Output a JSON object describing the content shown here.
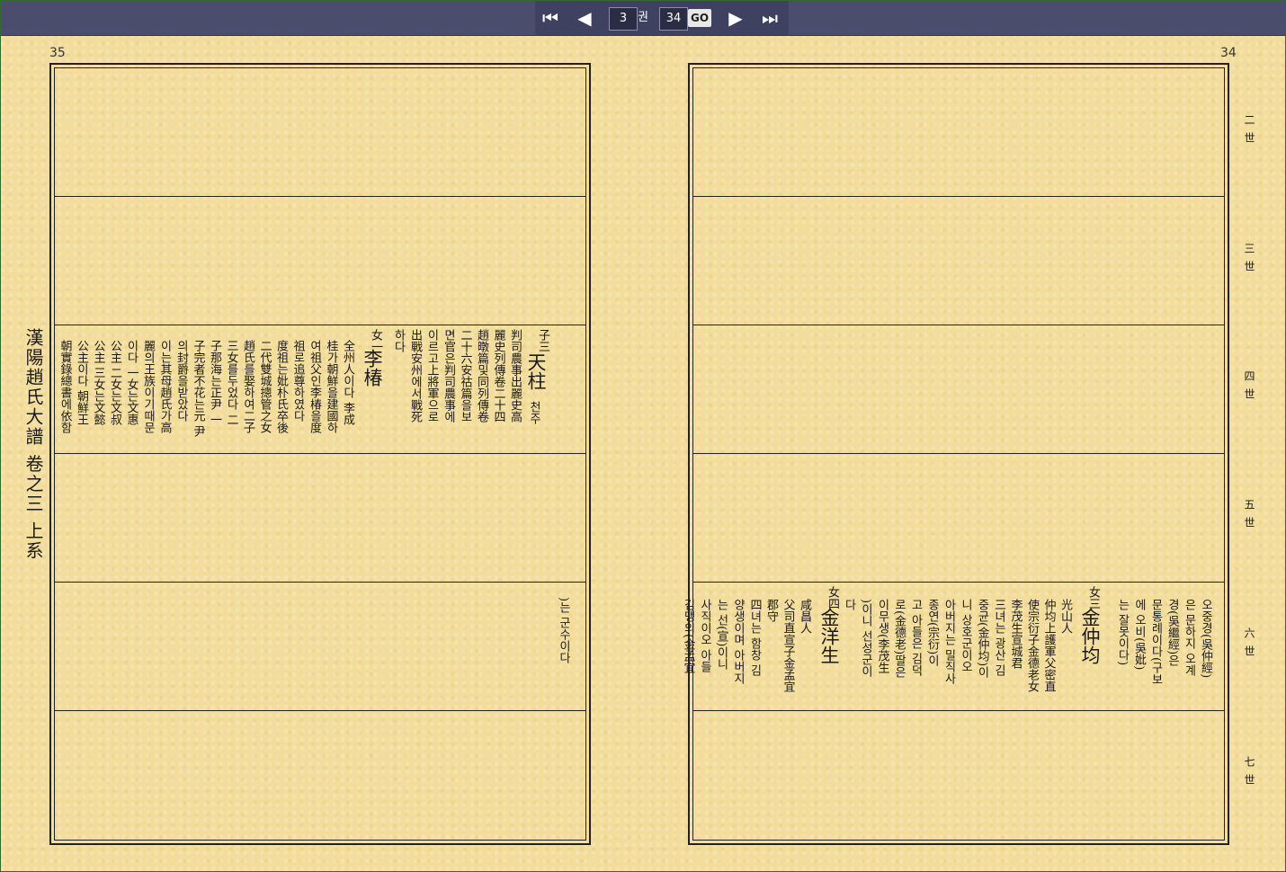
{
  "toolbar": {
    "first_icon": "⏮",
    "prev_icon": "◀",
    "next_icon": "▶",
    "last_icon": "⏭",
    "volume": "3",
    "volume_unit": "권",
    "page": "34",
    "go_label": "GO"
  },
  "left_page": {
    "number": "35",
    "side_title": "漢陽趙氏大譜 卷之三 上系",
    "entry_son": {
      "rank": "子三",
      "name": "天柱",
      "reading": "천주",
      "lines": [
        "判司農事出麗史高",
        "麗史列傳卷二十四",
        "趙暾篇및同列傳卷",
        "二十六安祜篇을보",
        "면官은判司農事에",
        "이르고上將軍으로",
        "出戰安州에서戰死",
        "하다"
      ]
    },
    "entry_daughter": {
      "rank": "女一",
      "name": "李椿",
      "lines": [
        "全州人이다 李成",
        "桂가朝鮮을建國하",
        "여祖父인李椿을度",
        "祖로追尊하였다",
        "度祖는妣朴氏卒後",
        "二代雙城摠管之女",
        "趙氏를娶하여二子",
        "三女를두었다 二",
        "子那海는正尹 一",
        "子完者不花는元 尹",
        "의封爵을받았다",
        "이는其母趙氏가高",
        "麗의王族이기때문",
        "이다 一女는文惠",
        "公主 二女는文叔",
        "公主 三女는文懿",
        "公主이다 朝鮮王",
        "朝實錄總書에依함"
      ]
    },
    "continuation": ")는 군수이다"
  },
  "right_page": {
    "number": "34",
    "generations": [
      "二世",
      "三世",
      "四世",
      "五世",
      "六世",
      "七世"
    ],
    "entry_three": {
      "rank": "女三",
      "name": "金仲均",
      "lines": [
        "光山人",
        "仲均上護軍父密直",
        "使宗衍子金德老女",
        "李茂生宣城君",
        "三녀는 광산 김",
        "중균(金仲均)이",
        "니 상호군이오",
        "아버지는 밀직사",
        "종연(宗衍)이",
        "고 아들은 김덕",
        "로(金德老)딸은",
        "이무생(李茂生",
        ")이니 선성군이",
        "다"
      ]
    },
    "entry_three_pre": [
      "오중경(吳仲經)",
      "은 문하지 오계",
      "경(吳繼經)은",
      "문통례이다(구보",
      "에 오비(吳妣)",
      "는 잘못이다)"
    ],
    "entry_four": {
      "rank": "女四",
      "name": "金洋生",
      "lines": [
        "咸昌人",
        "父司直宣子金孟宜",
        "郡守",
        "四녀는 함창 김",
        "양생이며 아버지",
        "는 선(宣)이니",
        "사직이오 아들",
        "김맹의(金孟宜"
      ]
    }
  }
}
